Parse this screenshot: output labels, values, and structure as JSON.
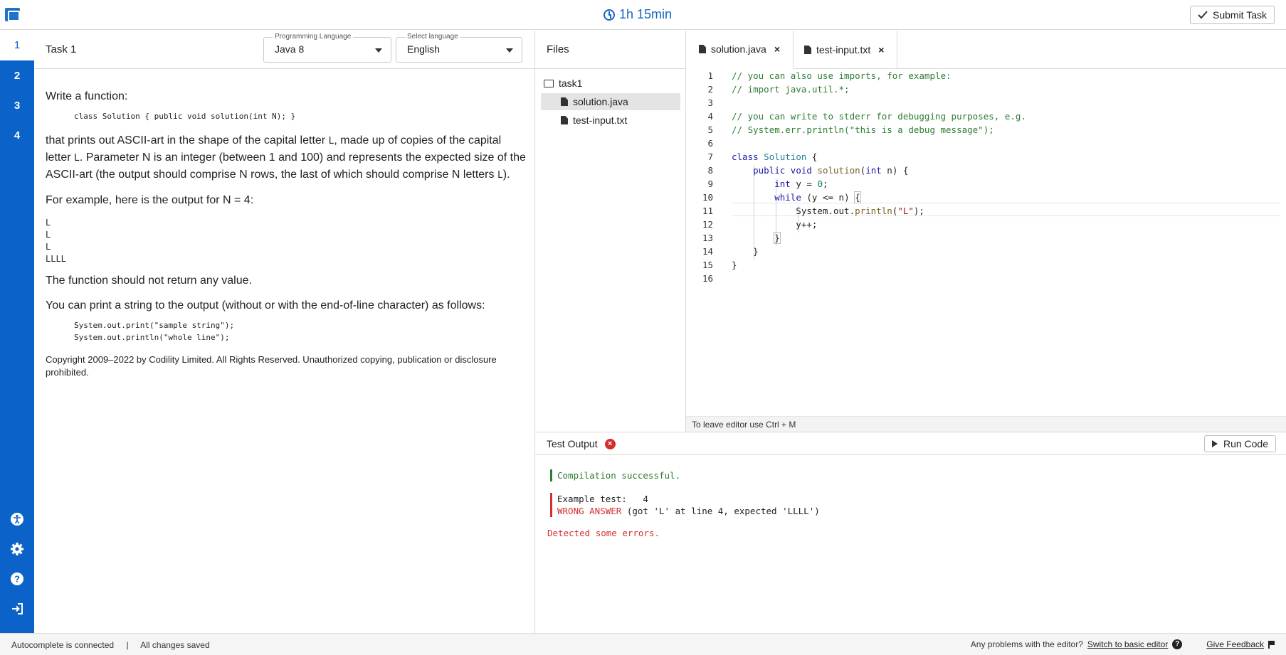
{
  "header": {
    "timer": "1h 15min",
    "submit_label": "Submit Task"
  },
  "sidenav": {
    "tasks": [
      "1",
      "2",
      "3",
      "4"
    ],
    "icons": [
      "accessibility-icon",
      "gear-icon",
      "help-icon",
      "logout-icon"
    ]
  },
  "task": {
    "title": "Task 1",
    "programming_language_label": "Programming Language",
    "programming_language_value": "Java 8",
    "select_language_label": "Select language",
    "select_language_value": "English",
    "intro": "Write a function:",
    "signature": "class Solution { public void solution(int N); }",
    "desc_1a": "that prints out ASCII-art in the shape of the capital letter ",
    "desc_1b": ", made up of copies of the capital letter ",
    "desc_1c": ". Parameter N is an integer (between 1 and 100) and represents the expected size of the ASCII-art (the output should comprise N rows, the last of which should comprise N letters ",
    "desc_1d": ").",
    "letter": "L",
    "example_intro": "For example, here is the output for N = 4:",
    "example_output": "L\nL\nL\nLLLL",
    "no_return": "The function should not return any value.",
    "print_intro": "You can print a string to the output (without or with the end-of-line character) as follows:",
    "print_code": "System.out.print(\"sample string\");\nSystem.out.println(\"whole line\");",
    "copyright": "Copyright 2009–2022 by Codility Limited. All Rights Reserved. Unauthorized copying, publication or disclosure prohibited."
  },
  "files": {
    "title": "Files",
    "folder": "task1",
    "items": [
      "solution.java",
      "test-input.txt"
    ]
  },
  "tabs": [
    "solution.java",
    "test-input.txt"
  ],
  "editor": {
    "line_numbers": [
      "1",
      "2",
      "3",
      "4",
      "5",
      "6",
      "7",
      "8",
      "9",
      "10",
      "11",
      "12",
      "13",
      "14",
      "15",
      "16"
    ],
    "hint": "To leave editor use Ctrl + M"
  },
  "output": {
    "title": "Test Output",
    "run_label": "Run Code",
    "compile": "Compilation successful.",
    "example_label": "Example test:   4",
    "wrong": "WRONG ANSWER",
    "wrong_detail": " (got 'L' at line 4, expected 'LLLL')",
    "detected": "Detected some errors."
  },
  "status": {
    "autocomplete": "Autocomplete is connected",
    "separator": "|",
    "saved": "All changes saved",
    "problems": "Any problems with the editor?",
    "switch_link": "Switch to basic editor",
    "feedback": "Give Feedback"
  },
  "colors": {
    "brand": "#0b63c9",
    "timer": "#1565c0",
    "success": "#2e7d32",
    "error": "#d32f2f"
  }
}
